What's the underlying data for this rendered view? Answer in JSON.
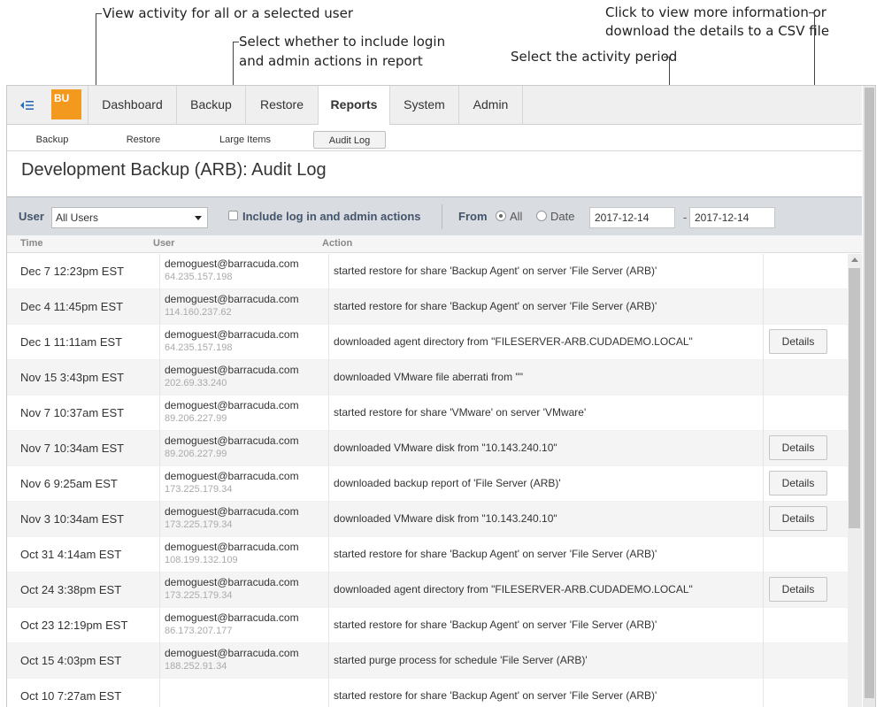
{
  "callouts": {
    "user": "View activity for all or a selected user",
    "login_line1": "Select whether to include login",
    "login_line2": "and admin actions in report",
    "period": "Select the activity period",
    "details_line1": "Click to view more information or",
    "details_line2": "download the details to a CSV file"
  },
  "nav": {
    "logo": "BU",
    "tabs": [
      "Dashboard",
      "Backup",
      "Restore",
      "Reports",
      "System",
      "Admin"
    ],
    "active_tab": "Reports"
  },
  "subnav": {
    "tabs": [
      "Backup",
      "Restore",
      "Large Items",
      "Audit Log"
    ],
    "active": "Audit Log"
  },
  "page": {
    "title": "Development Backup (ARB): Audit Log"
  },
  "filters": {
    "user_label": "User",
    "user_value": "All Users",
    "include_label": "Include log in and admin actions",
    "from_label": "From",
    "all_label": "All",
    "date_label": "Date",
    "date_from": "2017-12-14",
    "date_sep": "-",
    "date_to": "2017-12-14"
  },
  "columns": {
    "time": "Time",
    "user": "User",
    "action": "Action"
  },
  "details_label": "Details",
  "rows": [
    {
      "time": "Dec 7 12:23pm EST",
      "email": "demoguest@barracuda.com",
      "ip": "64.235.157.198",
      "action": "started restore for share 'Backup Agent' on server 'File Server (ARB)'",
      "details": false
    },
    {
      "time": "Dec 4 11:45pm EST",
      "email": "demoguest@barracuda.com",
      "ip": "114.160.237.62",
      "action": "started restore for share 'Backup Agent' on server 'File Server (ARB)'",
      "details": false
    },
    {
      "time": "Dec 1 11:11am EST",
      "email": "demoguest@barracuda.com",
      "ip": "64.235.157.198",
      "action": "downloaded agent directory from \"FILESERVER-ARB.CUDADEMO.LOCAL\"",
      "details": true
    },
    {
      "time": "Nov 15 3:43pm EST",
      "email": "demoguest@barracuda.com",
      "ip": "202.69.33.240",
      "action": "downloaded VMware file aberrati from \"\"",
      "details": false
    },
    {
      "time": "Nov 7 10:37am EST",
      "email": "demoguest@barracuda.com",
      "ip": "89.206.227.99",
      "action": "started restore for share 'VMware' on server 'VMware'",
      "details": false
    },
    {
      "time": "Nov 7 10:34am EST",
      "email": "demoguest@barracuda.com",
      "ip": "89.206.227.99",
      "action": "downloaded VMware disk from \"10.143.240.10\"",
      "details": true
    },
    {
      "time": "Nov 6 9:25am EST",
      "email": "demoguest@barracuda.com",
      "ip": "173.225.179.34",
      "action": "downloaded backup report of 'File Server (ARB)'",
      "details": true
    },
    {
      "time": "Nov 3 10:34am EST",
      "email": "demoguest@barracuda.com",
      "ip": "173.225.179.34",
      "action": "downloaded VMware disk from \"10.143.240.10\"",
      "details": true
    },
    {
      "time": "Oct 31 4:14am EST",
      "email": "demoguest@barracuda.com",
      "ip": "108.199.132.109",
      "action": "started restore for share 'Backup Agent' on server 'File Server (ARB)'",
      "details": false
    },
    {
      "time": "Oct 24 3:38pm EST",
      "email": "demoguest@barracuda.com",
      "ip": "173.225.179.34",
      "action": "downloaded agent directory from \"FILESERVER-ARB.CUDADEMO.LOCAL\"",
      "details": true
    },
    {
      "time": "Oct 23 12:19pm EST",
      "email": "demoguest@barracuda.com",
      "ip": "86.173.207.177",
      "action": "started restore for share 'Backup Agent' on server 'File Server (ARB)'",
      "details": false
    },
    {
      "time": "Oct 15 4:03pm EST",
      "email": "demoguest@barracuda.com",
      "ip": "188.252.91.34",
      "action": "started purge process for schedule 'File Server (ARB)'",
      "details": false
    },
    {
      "time": "Oct 10 7:27am EST",
      "email": "",
      "ip": "",
      "action": "started restore for share 'Backup Agent' on server 'File Server (ARB)'",
      "details": false
    }
  ]
}
